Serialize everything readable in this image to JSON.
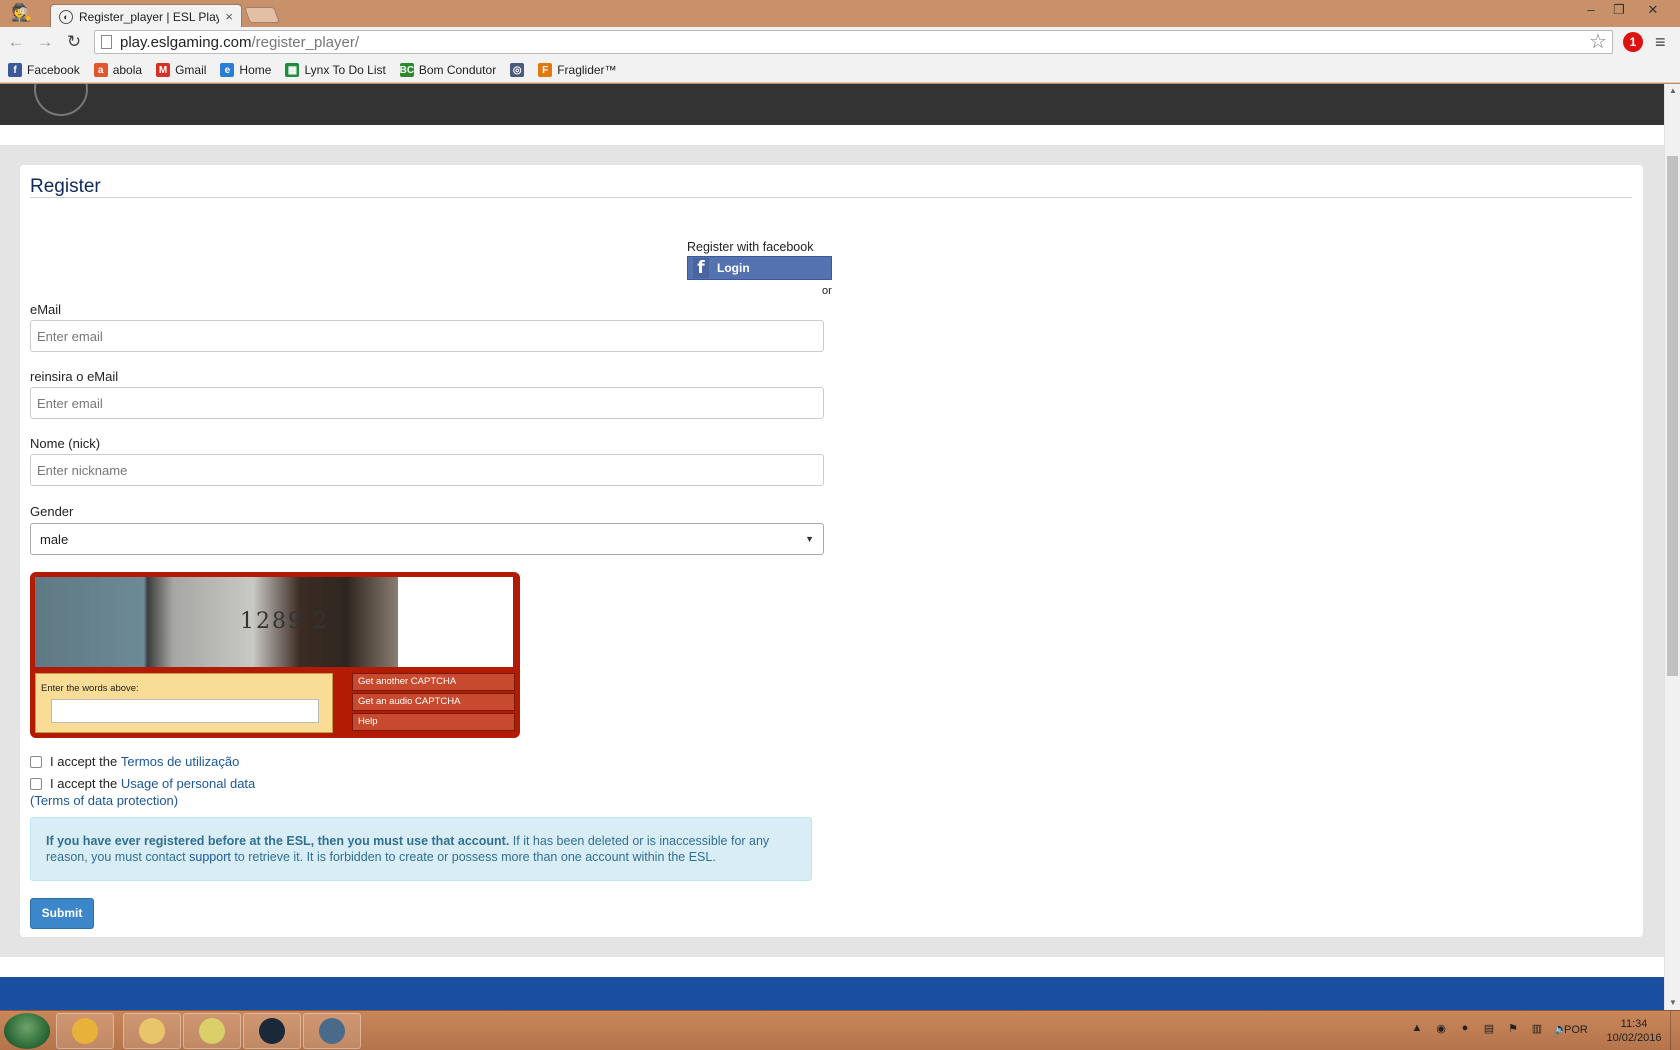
{
  "browser": {
    "tab_title": "Register_player | ESL Play",
    "tab_close": "×",
    "url_host": "play.eslgaming.com",
    "url_path": "/register_player/",
    "extension_badge": "1",
    "bookmarks": [
      {
        "label": "Facebook",
        "icon": "facebook-icon",
        "color": "#3b5998",
        "glyph": "f"
      },
      {
        "label": "abola",
        "icon": "abola-icon",
        "color": "#e2562b",
        "glyph": "a"
      },
      {
        "label": "Gmail",
        "icon": "gmail-icon",
        "color": "#d93025",
        "glyph": "M"
      },
      {
        "label": "Home",
        "icon": "home-icon",
        "color": "#2a7fd4",
        "glyph": "e"
      },
      {
        "label": "Lynx To Do List",
        "icon": "sheets-icon",
        "color": "#1e8e3e",
        "glyph": "▦"
      },
      {
        "label": "Bom Condutor",
        "icon": "bc-icon",
        "color": "#2b8a2b",
        "glyph": "BC"
      },
      {
        "label": "",
        "icon": "gamepad-icon",
        "color": "#4a5a7a",
        "glyph": "◎"
      },
      {
        "label": "Fraglider™",
        "icon": "fraglider-icon",
        "color": "#e07a10",
        "glyph": "F"
      }
    ]
  },
  "page": {
    "title": "Register",
    "facebook": {
      "label": "Register with facebook",
      "button": "Login",
      "or": "or"
    },
    "email": {
      "label": "eMail",
      "placeholder": "Enter email"
    },
    "email_confirm": {
      "label": "reinsira o eMail",
      "placeholder": "Enter email"
    },
    "nickname": {
      "label": "Nome (nick)",
      "placeholder": "Enter nickname"
    },
    "gender": {
      "label": "Gender",
      "value": "male"
    },
    "captcha": {
      "image_text": "1289 2",
      "prompt": "Enter the words above:",
      "buttons": [
        "Get another CAPTCHA",
        "Get an audio CAPTCHA",
        "Help"
      ]
    },
    "terms": {
      "prefix": "I accept the",
      "link": "Termos de utilização"
    },
    "privacy": {
      "prefix": "I accept the",
      "link": "Usage of personal data",
      "sub": "(Terms of data protection)"
    },
    "notice": {
      "bold": "If you have ever registered before at the ESL, then you must use that account.",
      "text1": " If it has been deleted or is inaccessible for any reason, you must contact ",
      "link": "support",
      "text2": " to retrieve it. It is forbidden to create or possess more than one account within the ESL."
    },
    "submit": "Submit"
  },
  "taskbar": {
    "language": "POR",
    "time": "11:34",
    "date": "10/02/2016",
    "apps": [
      {
        "name": "chrome",
        "color": "#e8b23a"
      },
      {
        "name": "file-explorer",
        "color": "#e8c46a"
      },
      {
        "name": "sticky-notes",
        "color": "#d9d06a"
      },
      {
        "name": "steam",
        "color": "#1b2838"
      },
      {
        "name": "teamspeak",
        "color": "#4a6a8a"
      }
    ]
  },
  "colors": {
    "accent_title": "#0c2a5b",
    "link": "#1b5797",
    "submit": "#3c87c9",
    "facebook": "#5471b0",
    "captcha_border": "#b31a04",
    "notice_bg": "#d9edf7"
  }
}
